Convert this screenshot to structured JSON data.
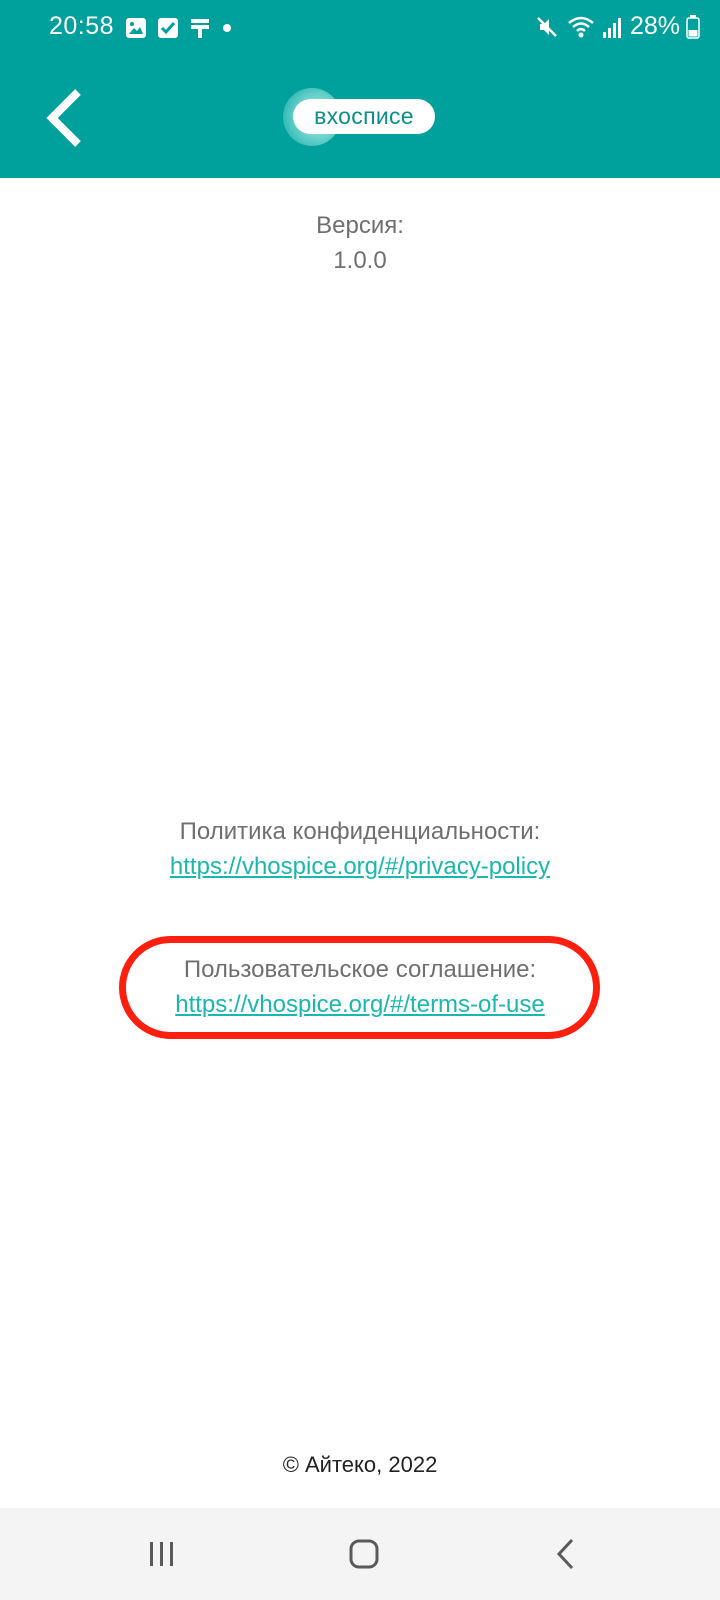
{
  "status_bar": {
    "time": "20:58",
    "left_icons": [
      "image-icon",
      "checkbox-icon",
      "cleaner-icon",
      "dot-icon"
    ],
    "right_icons": [
      "mute-icon",
      "wifi-icon",
      "signal-icon",
      "battery-icon"
    ],
    "battery_percent": "28%"
  },
  "app_bar": {
    "logo_text": "вхосписе",
    "colors": {
      "bar": "#00a19c",
      "logo_text": "#0a8f8a"
    }
  },
  "content": {
    "version_label": "Версия:",
    "version_value": "1.0.0",
    "privacy": {
      "label": "Политика конфиденциальности:",
      "link": "https://vhospice.org/#/privacy-policy"
    },
    "terms": {
      "label": "Пользовательское соглашение:",
      "link": "https://vhospice.org/#/terms-of-use"
    },
    "copyright": "© Айтеко, 2022",
    "colors": {
      "label": "#6f6f6f",
      "link": "#1bb7ae",
      "highlight": "#ff1f0f"
    }
  },
  "nav_bar": {
    "buttons": [
      "recents-icon",
      "home-icon",
      "back-icon"
    ]
  }
}
